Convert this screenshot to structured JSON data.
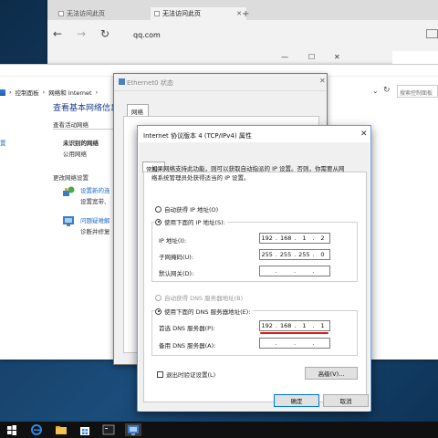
{
  "edge": {
    "tabs": [
      {
        "label": "无法访问此页"
      },
      {
        "label": "无法访问此页"
      }
    ],
    "new_tab": "+",
    "nav": {
      "back": "←",
      "forward": "→",
      "refresh": "↻"
    },
    "address": "qq.com"
  },
  "control_panel": {
    "breadcrumb": [
      "控制面板",
      "网络和 Internet"
    ],
    "search_placeholder": "搜索控制面板",
    "heading": "查看基本网络信息",
    "active_networks_label": "查看活动网络",
    "network_name": "未识别的网络",
    "network_type": "公用网络",
    "change_settings_label": "更改网络设置",
    "setup_link": "设置新的连",
    "setup_desc": "设置宽带、",
    "troubleshoot_link": "问题疑难解",
    "troubleshoot_desc": "诊断并修复",
    "sidebar_fragment": "置"
  },
  "status_window": {
    "title": "Ethernet0 状态",
    "tab": "网络"
  },
  "dialog": {
    "title": "Internet 协议版本 4 (TCP/IPv4) 属性",
    "close": "✕",
    "tab": "常规",
    "description_line1": "如果网络支持此功能，则可以获取自动指派的 IP 设置。否则，你需要从网",
    "description_line2": "络系统管理员处获得适当的 IP 设置。",
    "auto_ip_label": "自动获得 IP 地址(O)",
    "manual_ip_label": "使用下面的 IP 地址(S):",
    "ip_label": "IP 地址(I):",
    "ip_value": [
      "192",
      "168",
      "1",
      "2"
    ],
    "mask_label": "子网掩码(U):",
    "mask_value": [
      "255",
      "255",
      "255",
      "0"
    ],
    "gateway_label": "默认网关(D):",
    "gateway_value": [
      "",
      "",
      "",
      ""
    ],
    "auto_dns_label": "自动获得 DNS 服务器地址(B)",
    "manual_dns_label": "使用下面的 DNS 服务器地址(E):",
    "preferred_dns_label": "首选 DNS 服务器(P):",
    "preferred_dns_value": [
      "192",
      "168",
      "1",
      "1"
    ],
    "alternate_dns_label": "备用 DNS 服务器(A):",
    "alternate_dns_value": [
      "",
      "",
      "",
      ""
    ],
    "validate_label": "退出时验证设置(L)",
    "advanced_button": "高级(V)...",
    "ok_button": "确定",
    "cancel_button": "取消"
  },
  "colors": {
    "accent": "#0078d7",
    "link": "#1e6bd1",
    "heading": "#1e3f8c",
    "highlight_underline": "#d91c1c"
  }
}
